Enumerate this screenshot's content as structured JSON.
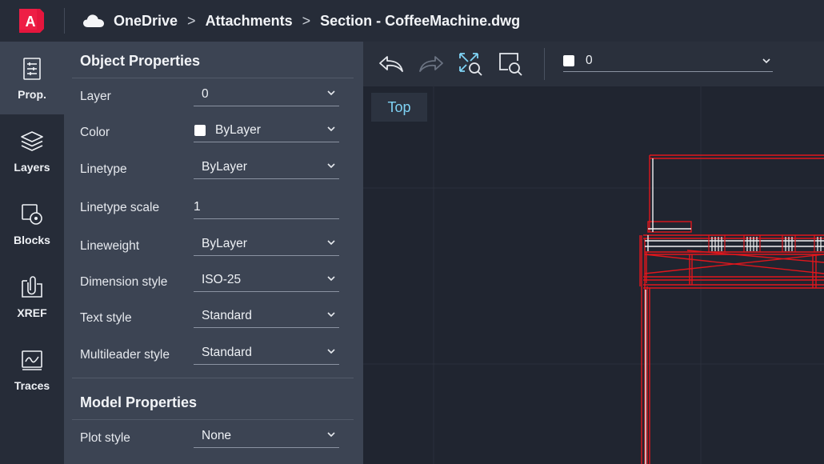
{
  "app": {
    "logo_letter": "A"
  },
  "breadcrumb": {
    "items": [
      "OneDrive",
      "Attachments",
      "Section - CoffeeMachine.dwg"
    ],
    "separator": ">"
  },
  "rail": {
    "items": [
      {
        "label": "Prop.",
        "icon": "properties-icon",
        "active": true
      },
      {
        "label": "Layers",
        "icon": "layers-icon"
      },
      {
        "label": "Blocks",
        "icon": "blocks-icon"
      },
      {
        "label": "XREF",
        "icon": "xref-icon"
      },
      {
        "label": "Traces",
        "icon": "traces-icon"
      }
    ]
  },
  "object_properties": {
    "title": "Object Properties",
    "rows": [
      {
        "label": "Layer",
        "value": "0"
      },
      {
        "label": "Color",
        "value": "ByLayer"
      },
      {
        "label": "Linetype",
        "value": "ByLayer"
      },
      {
        "label": "Linetype scale",
        "value": "1"
      },
      {
        "label": "Lineweight",
        "value": "ByLayer"
      },
      {
        "label": "Dimension style",
        "value": "ISO-25"
      },
      {
        "label": "Text style",
        "value": "Standard"
      },
      {
        "label": "Multileader style",
        "value": "Standard"
      }
    ]
  },
  "model_properties": {
    "title": "Model Properties",
    "rows": [
      {
        "label": "Plot style",
        "value": "None"
      }
    ]
  },
  "toolbar": {
    "icons": [
      "undo-icon",
      "redo-icon",
      "zoom-extents-icon",
      "zoom-window-icon"
    ],
    "layer_value": "0"
  },
  "canvas": {
    "view_label": "Top"
  },
  "colors": {
    "accent_logo": "#e5163d",
    "view_label_text": "#7fd3f5",
    "drawing_red": "#e0161c",
    "panel_bg": "#3c4453",
    "canvas_bg": "#202530"
  }
}
